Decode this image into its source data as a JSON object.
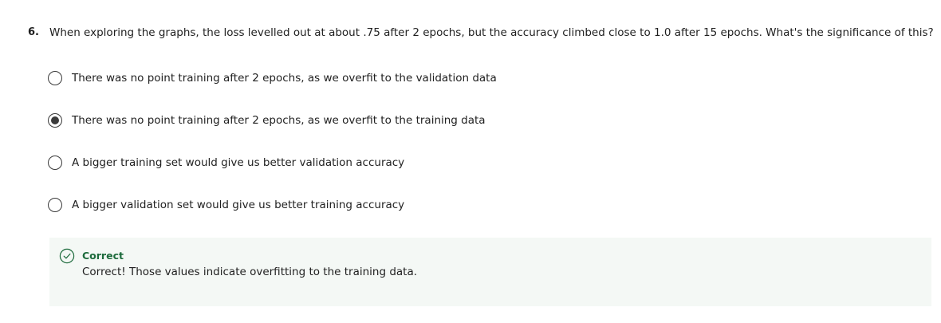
{
  "question": {
    "number": "6.",
    "text": "When exploring the graphs, the loss levelled out at about .75 after 2 epochs, but the accuracy climbed close to 1.0 after 15 epochs. What's the significance of this?",
    "options": [
      {
        "label": "There was no point training after 2 epochs, as we overfit to the validation data",
        "selected": false
      },
      {
        "label": "There was no point training after 2 epochs, as we overfit to the training data",
        "selected": true
      },
      {
        "label": "A bigger training set would give us better validation accuracy",
        "selected": false
      },
      {
        "label": "A bigger validation set would give us better training accuracy",
        "selected": false
      }
    ]
  },
  "feedback": {
    "icon": "check-circle-icon",
    "status": "Correct",
    "message": "Correct! Those values indicate overfitting to the training data.",
    "status_color": "#1d6b3c",
    "background_color": "#f4f8f5"
  }
}
